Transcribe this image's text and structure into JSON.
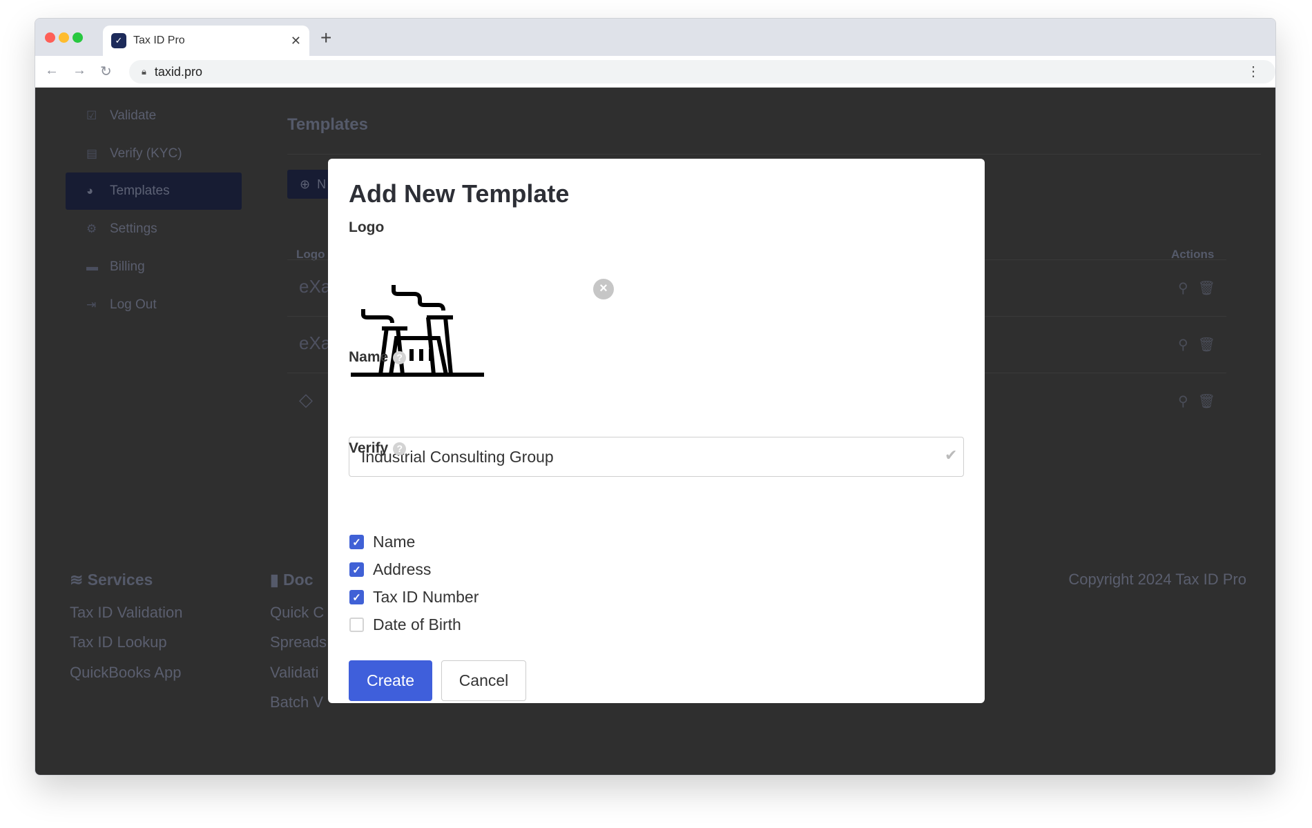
{
  "browser": {
    "tab_title": "Tax ID Pro",
    "url": "taxid.pro"
  },
  "sidebar": {
    "items": [
      {
        "label": "Validate",
        "icon": "check-square-icon"
      },
      {
        "label": "Verify (KYC)",
        "icon": "id-card-icon"
      },
      {
        "label": "Templates",
        "icon": "palette-icon",
        "active": true
      },
      {
        "label": "Settings",
        "icon": "gear-icon"
      },
      {
        "label": "Billing",
        "icon": "credit-card-icon"
      },
      {
        "label": "Log Out",
        "icon": "sign-out-icon"
      }
    ]
  },
  "main": {
    "title": "Templates",
    "new_button": "N",
    "table": {
      "headers": {
        "logo": "Logo",
        "actions": "Actions"
      },
      "rows": [
        {
          "logo": "eXa"
        },
        {
          "logo": "eXa"
        },
        {
          "logo": "◇"
        }
      ]
    }
  },
  "footer": {
    "services": {
      "heading": "Services",
      "links": [
        "Tax ID Validation",
        "Tax ID Lookup",
        "QuickBooks App"
      ]
    },
    "docs": {
      "heading": "Doc",
      "links": [
        "Quick C",
        "Spreads",
        "Validati",
        "Batch V"
      ]
    },
    "copyright": "Copyright 2024 Tax ID Pro"
  },
  "modal": {
    "title": "Add New Template",
    "logo_label": "Logo",
    "name_label": "Name",
    "name_value": "Industrial Consulting Group",
    "verify_label": "Verify",
    "options": [
      {
        "label": "Name",
        "checked": true
      },
      {
        "label": "Address",
        "checked": true
      },
      {
        "label": "Tax ID Number",
        "checked": true
      },
      {
        "label": "Date of Birth",
        "checked": false
      }
    ],
    "create_label": "Create",
    "cancel_label": "Cancel"
  },
  "colors": {
    "accent": "#3f5fdb",
    "overlay": "#2f2f2f"
  }
}
